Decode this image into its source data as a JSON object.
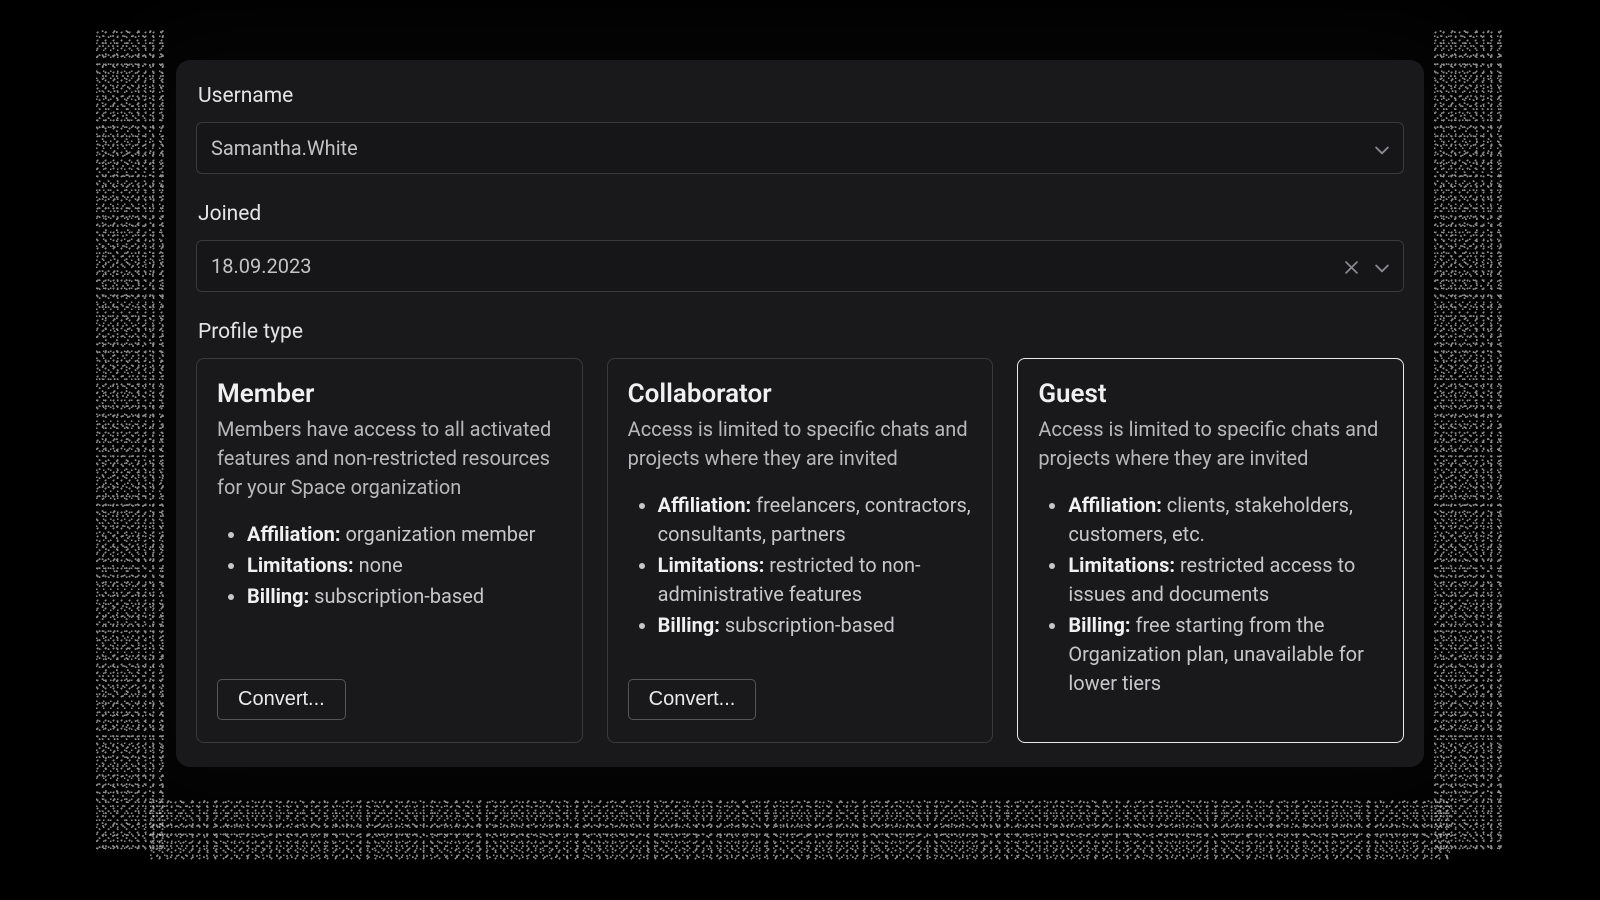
{
  "username": {
    "label": "Username",
    "value": "Samantha.White"
  },
  "joined": {
    "label": "Joined",
    "value": "18.09.2023"
  },
  "profile_type_label": "Profile type",
  "selected_profile_index": 2,
  "profiles": [
    {
      "title": "Member",
      "desc": "Members have access to all activated features and non-restricted resources for your Space organization",
      "bullets": [
        {
          "k": "Affiliation:",
          "v": " organization member"
        },
        {
          "k": "Limitations:",
          "v": " none"
        },
        {
          "k": "Billing:",
          "v": " subscription-based"
        }
      ],
      "button": "Convert..."
    },
    {
      "title": "Collaborator",
      "desc": "Access is limited to specific chats and projects where they are invited",
      "bullets": [
        {
          "k": "Affiliation:",
          "v": " freelancers, contractors, consultants, partners"
        },
        {
          "k": "Limitations:",
          "v": " restricted to non-administrative features"
        },
        {
          "k": "Billing:",
          "v": " subscription-based"
        }
      ],
      "button": "Convert..."
    },
    {
      "title": "Guest",
      "desc": "Access is limited to specific chats and projects where they are invited",
      "bullets": [
        {
          "k": "Affiliation:",
          "v": " clients, stakeholders, customers, etc."
        },
        {
          "k": "Limitations:",
          "v": " restricted access to issues and documents"
        },
        {
          "k": "Billing:",
          "v": " free starting from the Organization plan, unavailable for lower tiers"
        }
      ],
      "button": null
    }
  ]
}
